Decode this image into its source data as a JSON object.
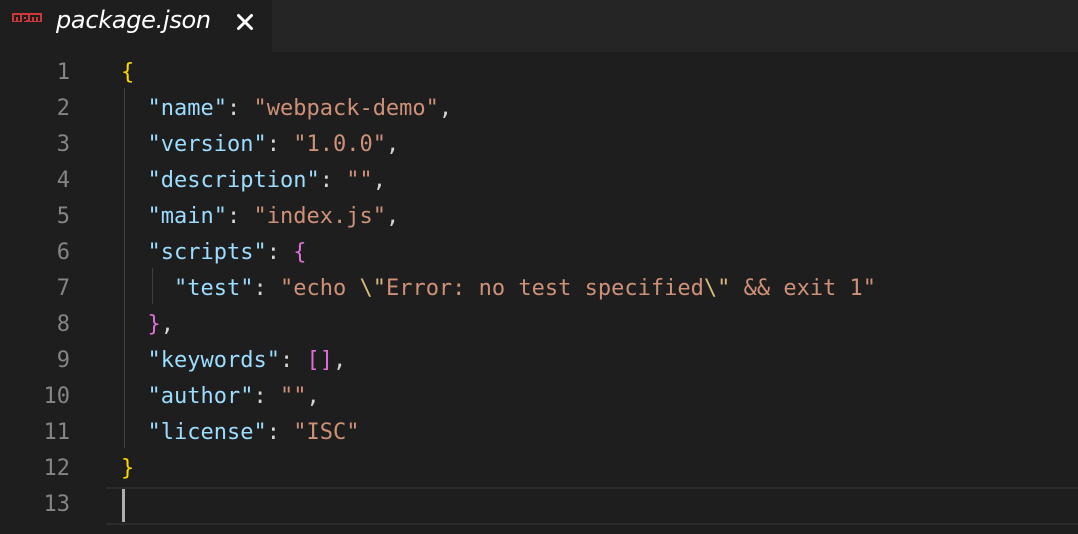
{
  "tab": {
    "title": "package.json",
    "icon": "npm-icon",
    "close_icon": "close-icon"
  },
  "colors": {
    "key": "#9cdcfe",
    "string": "#ce9178",
    "escape": "#d7ba7d",
    "punctuation": "#d4d4d4",
    "brace_outer": "#ffd700",
    "brace_inner": "#da70d6",
    "line_number": "#858585",
    "background": "#1e1e1e"
  },
  "lines": [
    {
      "number": "1",
      "tokens": [
        {
          "t": "{",
          "c": "b1"
        }
      ]
    },
    {
      "number": "2",
      "tokens": [
        {
          "t": "  "
        },
        {
          "t": "\"name\"",
          "c": "k"
        },
        {
          "t": ": ",
          "c": "p"
        },
        {
          "t": "\"webpack-demo\"",
          "c": "s"
        },
        {
          "t": ",",
          "c": "p"
        }
      ]
    },
    {
      "number": "3",
      "tokens": [
        {
          "t": "  "
        },
        {
          "t": "\"version\"",
          "c": "k"
        },
        {
          "t": ": ",
          "c": "p"
        },
        {
          "t": "\"1.0.0\"",
          "c": "s"
        },
        {
          "t": ",",
          "c": "p"
        }
      ]
    },
    {
      "number": "4",
      "tokens": [
        {
          "t": "  "
        },
        {
          "t": "\"description\"",
          "c": "k"
        },
        {
          "t": ": ",
          "c": "p"
        },
        {
          "t": "\"\"",
          "c": "s"
        },
        {
          "t": ",",
          "c": "p"
        }
      ]
    },
    {
      "number": "5",
      "tokens": [
        {
          "t": "  "
        },
        {
          "t": "\"main\"",
          "c": "k"
        },
        {
          "t": ": ",
          "c": "p"
        },
        {
          "t": "\"index.js\"",
          "c": "s"
        },
        {
          "t": ",",
          "c": "p"
        }
      ]
    },
    {
      "number": "6",
      "tokens": [
        {
          "t": "  "
        },
        {
          "t": "\"scripts\"",
          "c": "k"
        },
        {
          "t": ": ",
          "c": "p"
        },
        {
          "t": "{",
          "c": "b2"
        }
      ]
    },
    {
      "number": "7",
      "tokens": [
        {
          "t": "    "
        },
        {
          "t": "\"test\"",
          "c": "k"
        },
        {
          "t": ": ",
          "c": "p"
        },
        {
          "t": "\"echo ",
          "c": "s"
        },
        {
          "t": "\\\"",
          "c": "e"
        },
        {
          "t": "Error: no test specified",
          "c": "s"
        },
        {
          "t": "\\\"",
          "c": "e"
        },
        {
          "t": " && exit 1\"",
          "c": "s"
        }
      ]
    },
    {
      "number": "8",
      "tokens": [
        {
          "t": "  "
        },
        {
          "t": "}",
          "c": "b2"
        },
        {
          "t": ",",
          "c": "p"
        }
      ]
    },
    {
      "number": "9",
      "tokens": [
        {
          "t": "  "
        },
        {
          "t": "\"keywords\"",
          "c": "k"
        },
        {
          "t": ": ",
          "c": "p"
        },
        {
          "t": "[]",
          "c": "b2"
        },
        {
          "t": ",",
          "c": "p"
        }
      ]
    },
    {
      "number": "10",
      "tokens": [
        {
          "t": "  "
        },
        {
          "t": "\"author\"",
          "c": "k"
        },
        {
          "t": ": ",
          "c": "p"
        },
        {
          "t": "\"\"",
          "c": "s"
        },
        {
          "t": ",",
          "c": "p"
        }
      ]
    },
    {
      "number": "11",
      "tokens": [
        {
          "t": "  "
        },
        {
          "t": "\"license\"",
          "c": "k"
        },
        {
          "t": ": ",
          "c": "p"
        },
        {
          "t": "\"ISC\"",
          "c": "s"
        }
      ]
    },
    {
      "number": "12",
      "tokens": [
        {
          "t": "}",
          "c": "b1"
        }
      ]
    },
    {
      "number": "13",
      "tokens": []
    }
  ]
}
